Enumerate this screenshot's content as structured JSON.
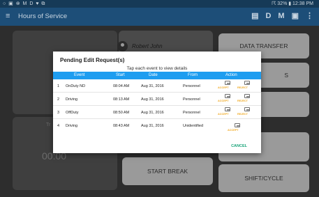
{
  "statusbar": {
    "left_icons": "○ ▣ ⊗ M D ♥ ⧉",
    "right": "☈ 32% ▮ 12:38 PM"
  },
  "appbar": {
    "menu_icon": "≡",
    "title": "Hours of Service",
    "actions": [
      "▤",
      "D",
      "M",
      "▣",
      "⋮"
    ]
  },
  "background": {
    "user_name": "Robert John",
    "tiles": [
      "DATA TRANSFER",
      "S",
      "START BREAK",
      "SHIFT/CYCLE"
    ],
    "time_display": "00:00",
    "truncated": "Tr"
  },
  "dialog": {
    "title": "Pending Edit Request(s)",
    "hint": "Tap each event to view details",
    "columns": [
      "Event",
      "Start",
      "Date",
      "From",
      "Action"
    ],
    "rows": [
      {
        "num": "1",
        "event": "OnDuty ND",
        "start": "08:04 AM",
        "date": "Aug 31, 2016",
        "from": "Personnel",
        "accept": "ACCEPT",
        "reject": "REJECT"
      },
      {
        "num": "2",
        "event": "Driving",
        "start": "08:13 AM",
        "date": "Aug 31, 2016",
        "from": "Personnel",
        "accept": "ACCEPT",
        "reject": "REJECT"
      },
      {
        "num": "3",
        "event": "OffDuty",
        "start": "08:50 AM",
        "date": "Aug 31, 2016",
        "from": "Personnel",
        "accept": "ACCEPT",
        "reject": "REJECT"
      },
      {
        "num": "4",
        "event": "Driving",
        "start": "08:43 AM",
        "date": "Aug 31, 2016",
        "from": "Unidentified",
        "accept": "ACCEPT",
        "reject": ""
      }
    ],
    "cancel_label": "CANCEL"
  },
  "colors": {
    "appbar": "#1d4e78",
    "header": "#1e9df0",
    "accept": "#f0a81f",
    "cancel": "#1aa57a"
  }
}
